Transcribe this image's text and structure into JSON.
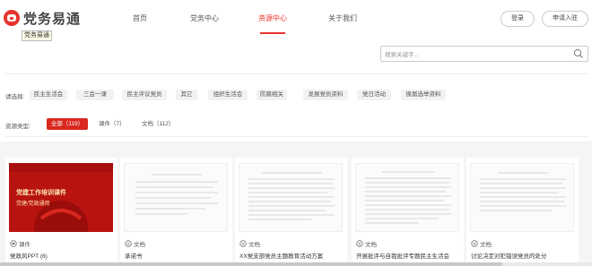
{
  "header": {
    "logo_text": "党务易通",
    "tooltip": "党务易通",
    "nav": [
      "首页",
      "党务中心",
      "资源中心",
      "关于我们"
    ],
    "login": "登录",
    "join": "申请入驻"
  },
  "search": {
    "placeholder": "搜索关键字..."
  },
  "filter": {
    "label": "请选择:",
    "chips": [
      "民主生活会",
      "三会一课",
      "民主评议党员",
      "其它",
      "组织生活会",
      "防腐相关",
      "发展党员资料",
      "党日活动",
      "换届选举资料"
    ]
  },
  "types": {
    "label": "资源类型:",
    "items": [
      "全部（119）",
      "课件（7）",
      "文档（112）"
    ]
  },
  "cards": [
    {
      "type": "课件",
      "title": "党政风PPT (6)",
      "thumb_text": [
        "党建工作培训课件",
        "党建/党政通用"
      ]
    },
    {
      "type": "文档",
      "title": "承诺书"
    },
    {
      "type": "文档",
      "title": "XX党支部党员主题教育活动方案"
    },
    {
      "type": "文档",
      "title": "开展批评与自我批评专题民主生活会"
    },
    {
      "type": "文档",
      "title": "讨论决定对犯错误党员的处分"
    }
  ],
  "colors": {
    "accent": "#e8342e",
    "active_chip": "#d8281f"
  }
}
